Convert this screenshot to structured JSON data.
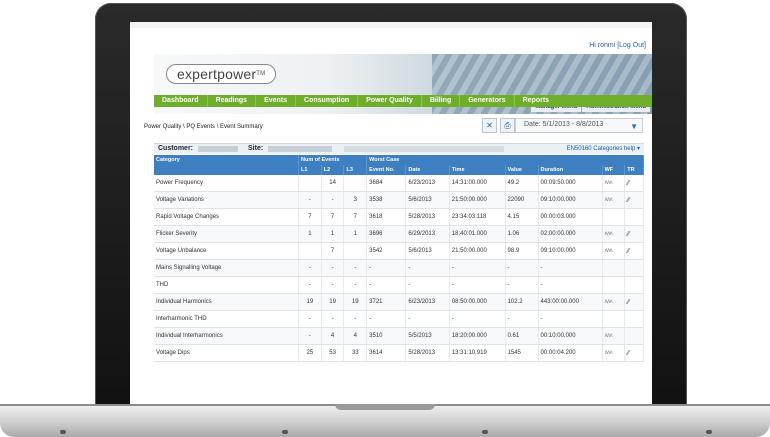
{
  "user": {
    "greeting": "Hi ronmi [Log Out]"
  },
  "logo": {
    "text": "expertpower",
    "tm": "TM"
  },
  "menus": {
    "manager": "Manager Menu",
    "admin": "Administration Menu"
  },
  "nav": [
    "Dashboard",
    "Readings",
    "Events",
    "Consumption",
    "Power Quality",
    "Billing",
    "Generators",
    "Reports"
  ],
  "breadcrumb": "Power Quality \\ PQ Events \\ Event Summary",
  "date_range": "Date: 5/1/2013 - 8/8/2013",
  "customer_label": "Customer:",
  "site_label": "Site:",
  "en_link": "EN50160 Categories help ▾",
  "table": {
    "group_headers": {
      "category": "Category",
      "num_events": "Num of Events",
      "worst_case": "Worst Case"
    },
    "sub_headers": [
      "L1",
      "L2",
      "L3",
      "Event No.",
      "Date",
      "Time",
      "Value",
      "Duration",
      "WF",
      "TR"
    ],
    "rows": [
      {
        "category": "Power Frequency",
        "l1": "",
        "l2": "14",
        "l3": "",
        "event_no": "3684",
        "date": "6/23/2013",
        "time": "14:31:00.000",
        "value": "49.2",
        "duration": "00:09:50.000",
        "wf": "ʌʌʌ",
        "tr": "⁄⁄"
      },
      {
        "category": "Voltage Variations",
        "l1": "-",
        "l2": "-",
        "l3": "3",
        "event_no": "3538",
        "date": "5/6/2013",
        "time": "21:50:00.000",
        "value": "22090",
        "duration": "09:10:00.000",
        "wf": "ʌʌʌ",
        "tr": "⁄⁄"
      },
      {
        "category": "Rapid Voltage Changes",
        "l1": "7",
        "l2": "7",
        "l3": "7",
        "event_no": "3618",
        "date": "5/28/2013",
        "time": "23:34:03.118",
        "value": "4.15",
        "duration": "00:00:03.000",
        "wf": "",
        "tr": ""
      },
      {
        "category": "Flicker Severity",
        "l1": "1",
        "l2": "1",
        "l3": "1",
        "event_no": "3696",
        "date": "6/29/2013",
        "time": "18:40:01.000",
        "value": "1.06",
        "duration": "02:00:00.000",
        "wf": "ʌʌʌ",
        "tr": "⁄⁄"
      },
      {
        "category": "Voltage Unbalance",
        "l1": "",
        "l2": "7",
        "l3": "",
        "event_no": "3542",
        "date": "5/6/2013",
        "time": "21:50:00.000",
        "value": "98.9",
        "duration": "09:10:00.000",
        "wf": "ʌʌʌ",
        "tr": "⁄⁄"
      },
      {
        "category": "Mains Signalling Voltage",
        "l1": "-",
        "l2": "-",
        "l3": "-",
        "event_no": "-",
        "date": "-",
        "time": "-",
        "value": "-",
        "duration": "-",
        "wf": "",
        "tr": ""
      },
      {
        "category": "THD",
        "l1": "-",
        "l2": "-",
        "l3": "-",
        "event_no": "-",
        "date": "-",
        "time": "-",
        "value": "-",
        "duration": "-",
        "wf": "",
        "tr": ""
      },
      {
        "category": "Individual Harmonics",
        "l1": "19",
        "l2": "19",
        "l3": "19",
        "event_no": "3721",
        "date": "6/23/2013",
        "time": "08:50:00.000",
        "value": "102.2",
        "duration": "443:00:00.000",
        "wf": "ʌʌʌ",
        "tr": "⁄⁄"
      },
      {
        "category": "Interharmonic THD",
        "l1": "-",
        "l2": "-",
        "l3": "-",
        "event_no": "-",
        "date": "-",
        "time": "-",
        "value": "-",
        "duration": "-",
        "wf": "",
        "tr": ""
      },
      {
        "category": "Individual Interharmonics",
        "l1": "-",
        "l2": "4",
        "l3": "4",
        "event_no": "3510",
        "date": "5/5/2013",
        "time": "18:20:00.000",
        "value": "0.61",
        "duration": "00:10:00.000",
        "wf": "ʌʌʌ",
        "tr": ""
      },
      {
        "category": "Voltage Dips",
        "l1": "25",
        "l2": "53",
        "l3": "33",
        "event_no": "3614",
        "date": "5/28/2013",
        "time": "13:31:10.919",
        "value": "1545",
        "duration": "00:00:04.200",
        "wf": "ʌʌʌ",
        "tr": "⁄⁄"
      }
    ]
  }
}
